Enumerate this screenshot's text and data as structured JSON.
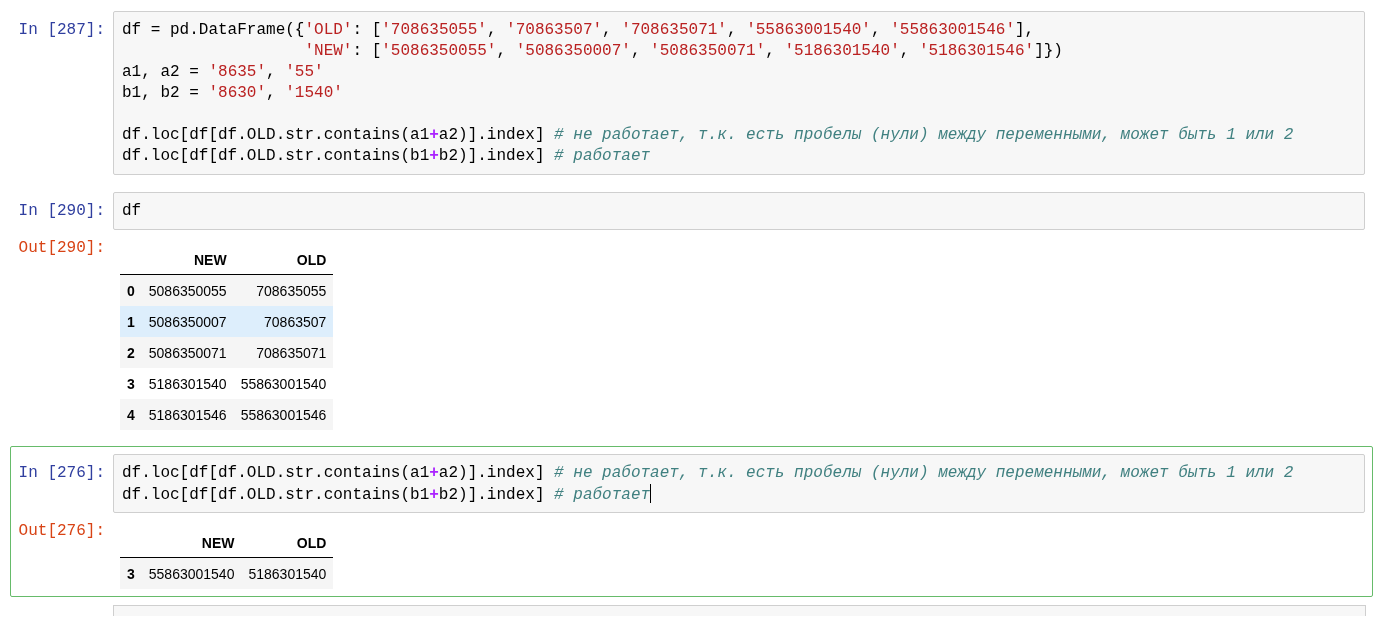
{
  "cells": [
    {
      "prompt": "In [287]:",
      "selected": false,
      "cursor": false,
      "lines": [
        [
          {
            "kind": "plain",
            "text": "df = pd.DataFrame({"
          },
          {
            "kind": "string",
            "text": "'OLD'"
          },
          {
            "kind": "plain",
            "text": ": ["
          },
          {
            "kind": "string",
            "text": "'708635055'"
          },
          {
            "kind": "plain",
            "text": ", "
          },
          {
            "kind": "string",
            "text": "'70863507'"
          },
          {
            "kind": "plain",
            "text": ", "
          },
          {
            "kind": "string",
            "text": "'708635071'"
          },
          {
            "kind": "plain",
            "text": ", "
          },
          {
            "kind": "string",
            "text": "'55863001540'"
          },
          {
            "kind": "plain",
            "text": ", "
          },
          {
            "kind": "string",
            "text": "'55863001546'"
          },
          {
            "kind": "plain",
            "text": "],"
          }
        ],
        [
          {
            "kind": "string",
            "text": "                   'NEW'"
          },
          {
            "kind": "plain",
            "text": ": ["
          },
          {
            "kind": "string",
            "text": "'5086350055'"
          },
          {
            "kind": "plain",
            "text": ", "
          },
          {
            "kind": "string",
            "text": "'5086350007'"
          },
          {
            "kind": "plain",
            "text": ", "
          },
          {
            "kind": "string",
            "text": "'5086350071'"
          },
          {
            "kind": "plain",
            "text": ", "
          },
          {
            "kind": "string",
            "text": "'5186301540'"
          },
          {
            "kind": "plain",
            "text": ", "
          },
          {
            "kind": "string",
            "text": "'5186301546'"
          },
          {
            "kind": "plain",
            "text": "]})"
          }
        ],
        [
          {
            "kind": "plain",
            "text": "a1, a2 = "
          },
          {
            "kind": "string",
            "text": "'8635'"
          },
          {
            "kind": "plain",
            "text": ", "
          },
          {
            "kind": "string",
            "text": "'55'"
          }
        ],
        [
          {
            "kind": "plain",
            "text": "b1, b2 = "
          },
          {
            "kind": "string",
            "text": "'8630'"
          },
          {
            "kind": "plain",
            "text": ", "
          },
          {
            "kind": "string",
            "text": "'1540'"
          }
        ],
        [
          {
            "kind": "blank"
          },
          {
            "kind": "plain",
            "text": "df.loc[df[df.OLD.str.contains(a1"
          },
          {
            "kind": "operator",
            "text": "+"
          },
          {
            "kind": "plain",
            "text": "a2)].index] "
          },
          {
            "kind": "comment",
            "text": "# не работает, т.к. есть пробелы (нули) между переменными, может быть 1 или 2"
          }
        ],
        [
          {
            "kind": "plain",
            "text": "df.loc[df[df.OLD.str.contains(b1"
          },
          {
            "kind": "operator",
            "text": "+"
          },
          {
            "kind": "plain",
            "text": "b2)].index] "
          },
          {
            "kind": "comment",
            "text": "# работает"
          }
        ]
      ]
    },
    {
      "prompt": "In [290]:",
      "selected": false,
      "cursor": false,
      "lines": [
        [
          {
            "kind": "plain",
            "text": "df"
          }
        ]
      ],
      "output": {
        "prompt": "Out[290]:",
        "columns": [
          "NEW",
          "OLD"
        ],
        "rows": [
          {
            "index": "0",
            "values": [
              "5086350055",
              "708635055"
            ],
            "highlighted": false
          },
          {
            "index": "1",
            "values": [
              "5086350007",
              "70863507"
            ],
            "highlighted": true
          },
          {
            "index": "2",
            "values": [
              "5086350071",
              "708635071"
            ],
            "highlighted": false
          },
          {
            "index": "3",
            "values": [
              "5186301540",
              "55863001540"
            ],
            "highlighted": false
          },
          {
            "index": "4",
            "values": [
              "5186301546",
              "55863001546"
            ],
            "highlighted": false
          }
        ]
      }
    },
    {
      "prompt": "In [276]:",
      "selected": true,
      "cursor": true,
      "lines": [
        [
          {
            "kind": "plain",
            "text": "df.loc[df[df.OLD.str.contains(a1"
          },
          {
            "kind": "operator",
            "text": "+"
          },
          {
            "kind": "plain",
            "text": "a2)].index] "
          },
          {
            "kind": "comment",
            "text": "# не работает, т.к. есть пробелы (нули) между переменными, может быть 1 или 2"
          }
        ],
        [
          {
            "kind": "plain",
            "text": "df.loc[df[df.OLD.str.contains(b1"
          },
          {
            "kind": "operator",
            "text": "+"
          },
          {
            "kind": "plain",
            "text": "b2)].index] "
          },
          {
            "kind": "comment",
            "text": "# работает"
          }
        ]
      ],
      "output": {
        "prompt": "Out[276]:",
        "columns": [
          "NEW",
          "OLD"
        ],
        "rows": [
          {
            "index": "3",
            "values": [
              "55863001540",
              "5186301540"
            ],
            "highlighted": false
          }
        ]
      }
    }
  ]
}
